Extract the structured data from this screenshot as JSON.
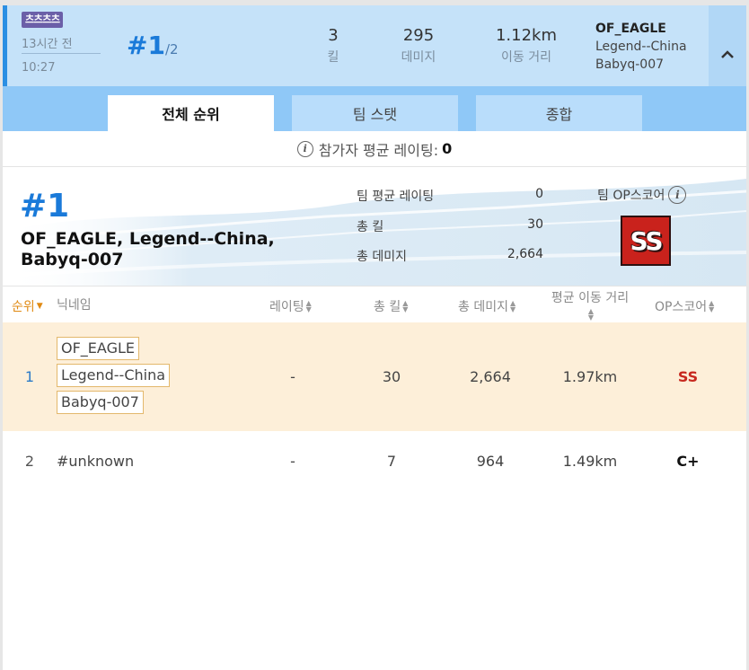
{
  "header": {
    "mode_badge": "츠츠츠츠",
    "time_ago": "13시간 전",
    "time_clock": "10:27",
    "place": "#1",
    "place_total": "/2",
    "stats": [
      {
        "value": "3",
        "label": "킬"
      },
      {
        "value": "295",
        "label": "데미지"
      },
      {
        "value": "1.12km",
        "label": "이동 거리"
      }
    ],
    "team": [
      "OF_EAGLE",
      "Legend--China",
      "Babyq-007"
    ]
  },
  "tabs": [
    {
      "label": "전체 순위",
      "active": true
    },
    {
      "label": "팀 스탯",
      "active": false
    },
    {
      "label": "종합",
      "active": false
    }
  ],
  "avg_rating": {
    "label": "참가자 평균 레이팅:",
    "value": "0"
  },
  "team_summary": {
    "rank": "#1",
    "names": "OF_EAGLE, Legend--China, Babyq-007",
    "stats": [
      {
        "label": "팀 평균 레이팅",
        "value": "0"
      },
      {
        "label": "총 킬",
        "value": "30"
      },
      {
        "label": "총 데미지",
        "value": "2,664"
      }
    ],
    "op_title": "팀 OP스코어",
    "op_grade": "SS"
  },
  "table": {
    "headers": {
      "rank": "순위",
      "nickname": "닉네임",
      "rating": "레이팅",
      "kills": "총 킬",
      "damage": "총 데미지",
      "distance": "평균 이동 거리",
      "op": "OP스코어"
    },
    "rows": [
      {
        "rank": "1",
        "names": [
          "OF_EAGLE",
          "Legend--China",
          "Babyq-007"
        ],
        "rating": "-",
        "kills": "30",
        "damage": "2,664",
        "distance": "1.97km",
        "op": "SS"
      },
      {
        "rank": "2",
        "names": [
          "#unknown"
        ],
        "rating": "-",
        "kills": "7",
        "damage": "964",
        "distance": "1.49km",
        "op": "C+"
      }
    ]
  },
  "colors": {
    "header_bg": "#c5e2f9",
    "accent_blue": "#1a7ad9",
    "tab_bar": "#8fc8f7",
    "highlight_row": "#fdefd9",
    "op_ss": "#c7281e",
    "sort_active": "#e08a13"
  },
  "icons": [
    "info-icon",
    "chevron-up-icon",
    "sort-arrows-icon",
    "sort-down-icon"
  ]
}
